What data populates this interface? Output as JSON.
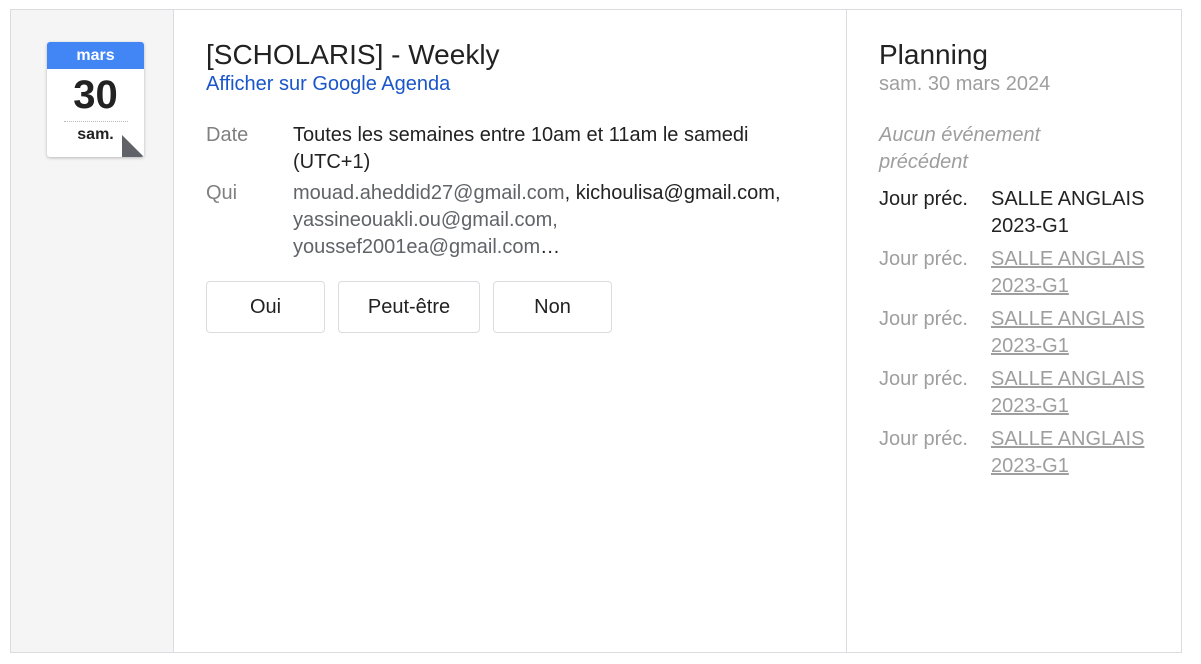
{
  "calendar_icon": {
    "month": "mars",
    "day": "30",
    "weekday": "sam."
  },
  "event": {
    "title": "[SCHOLARIS] - Weekly",
    "gcal_link": "Afficher sur Google Agenda",
    "date_label": "Date",
    "date_value": "Toutes les semaines entre 10am et 11am le samedi (UTC+1)",
    "who_label": "Qui",
    "guests": [
      "mouad.aheddid27@gmail.com",
      "kichoulisa@gmail.com,",
      "yassineouakli.ou@gmail.com,",
      "youssef2001ea@gmail.com",
      "…"
    ],
    "guest_separator": ", "
  },
  "rsvp": {
    "yes": "Oui",
    "maybe": "Peut-être",
    "no": "Non"
  },
  "planning": {
    "title": "Planning",
    "date": "sam. 30 mars 2024",
    "no_previous": "Aucun événement précédent",
    "items": [
      {
        "when": "Jour préc.",
        "what": "SALLE ANGLAIS 2023-G1"
      },
      {
        "when": "Jour préc.",
        "what": "SALLE ANGLAIS 2023-G1"
      },
      {
        "when": "Jour préc.",
        "what": "SALLE ANGLAIS 2023-G1"
      },
      {
        "when": "Jour préc.",
        "what": "SALLE ANGLAIS 2023-G1"
      },
      {
        "when": "Jour préc.",
        "what": "SALLE ANGLAIS 2023-G1"
      }
    ]
  },
  "colors": {
    "accent": "#4285f4",
    "link": "#1a56c9",
    "muted": "#9e9e9e",
    "border": "#dadce0"
  }
}
